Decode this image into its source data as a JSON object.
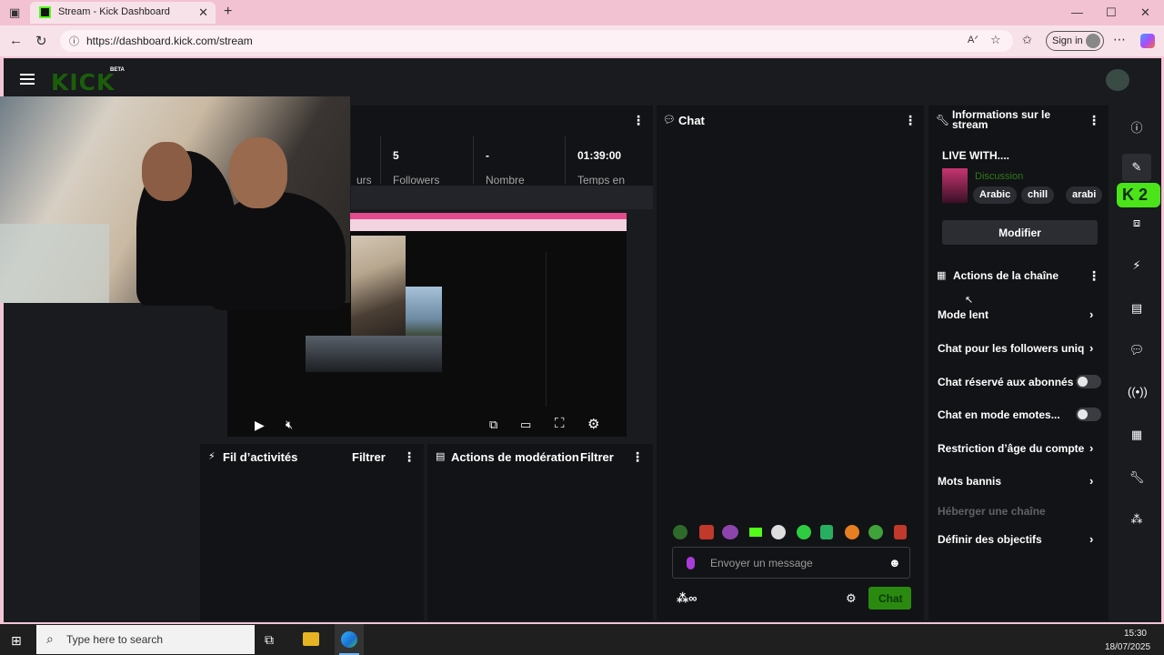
{
  "browser": {
    "tab_title": "Stream - Kick Dashboard",
    "url": "https://dashboard.kick.com/stream",
    "signin_label": "Sign in"
  },
  "app": {
    "logo": "KICK",
    "beta": "BETA"
  },
  "stats": [
    {
      "value": "",
      "label": "urs"
    },
    {
      "value": "5",
      "label": "Followers"
    },
    {
      "value": "-",
      "label": "Nombre"
    },
    {
      "value": "01:39:00",
      "label": "Temps en"
    }
  ],
  "activity": {
    "title": "Fil d’activités",
    "filter": "Filtrer"
  },
  "moderation": {
    "title": "Actions de modération",
    "filter": "Filtrer"
  },
  "chat": {
    "title": "Chat",
    "placeholder": "Envoyer un message",
    "send_label": "Chat"
  },
  "info": {
    "title_line1": "Informations sur le",
    "title_line2": "stream",
    "stream_title": "LIVE WITH....",
    "category": "Discussion",
    "tags": [
      "Arabic",
      "chill",
      "arabi"
    ],
    "modify_label": "Modifier"
  },
  "channel_actions": {
    "title": "Actions de la chaîne",
    "items": [
      {
        "label": "Mode lent",
        "control": "chevron"
      },
      {
        "label": "Chat pour les followers uniqu",
        "control": "chevron"
      },
      {
        "label": "Chat réservé aux abonnés",
        "control": "toggle"
      },
      {
        "label": "Chat en mode emotes...",
        "control": "toggle"
      },
      {
        "label": "Restriction d’âge du compte",
        "control": "chevron"
      },
      {
        "label": "Mots bannis",
        "control": "chevron"
      },
      {
        "label": "Héberger une chaîne",
        "control": "none"
      },
      {
        "label": "Définir des objectifs",
        "control": "chevron"
      }
    ]
  },
  "sidebar_badge": "K 2",
  "taskbar": {
    "search_placeholder": "Type here to search",
    "time": "15:30",
    "date": "18/07/2025"
  },
  "colors": {
    "kick_green": "#53fc18",
    "panel_bg": "#121316",
    "app_bg": "#191b1f",
    "browser_pink": "#f2c2d3"
  }
}
